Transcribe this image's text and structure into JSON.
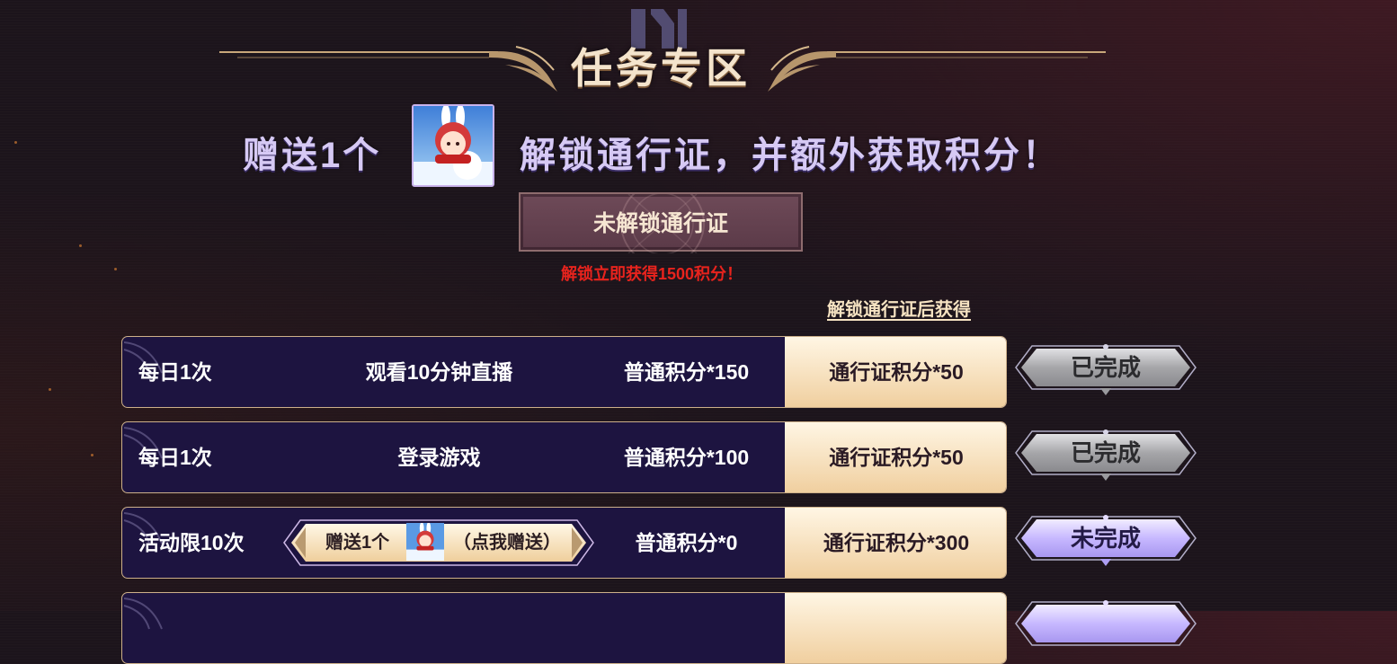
{
  "header": {
    "title": "任务专区",
    "subtitle_prefix": "赠送1个",
    "subtitle_suffix": "解锁通行证，并额外获取积分！",
    "gift_item_icon": "snow-bunny-girl-avatar-icon"
  },
  "pass": {
    "status_label": "未解锁通行证",
    "unlock_note": "解锁立即获得1500积分！",
    "column_header": "解锁通行证后获得"
  },
  "tasks": [
    {
      "frequency": "每日1次",
      "description": "观看10分钟直播",
      "normal_points": "普通积分*150",
      "pass_points": "通行证积分*50",
      "status": "已完成",
      "state": "completed"
    },
    {
      "frequency": "每日1次",
      "description": "登录游戏",
      "normal_points": "普通积分*100",
      "pass_points": "通行证积分*50",
      "status": "已完成",
      "state": "completed"
    },
    {
      "frequency": "活动限10次",
      "gift_button": {
        "prefix": "赠送1个",
        "suffix": "（点我赠送）",
        "icon": "snow-bunny-girl-avatar-icon"
      },
      "normal_points": "普通积分*0",
      "pass_points": "通行证积分*300",
      "status": "未完成",
      "state": "incomplete"
    },
    {
      "frequency": "",
      "state": "incomplete"
    }
  ],
  "colors": {
    "background": "#1c141b",
    "row_background": "#1d1440",
    "row_border": "#cdb08a",
    "pass_cell": "#f0cf9f",
    "alert_red": "#e8231d",
    "done_button": "#a3a3a6",
    "todo_button": "#c7b8ff",
    "title_text": "#f4e4cc",
    "subtitle_text": "#d6c9f4"
  }
}
